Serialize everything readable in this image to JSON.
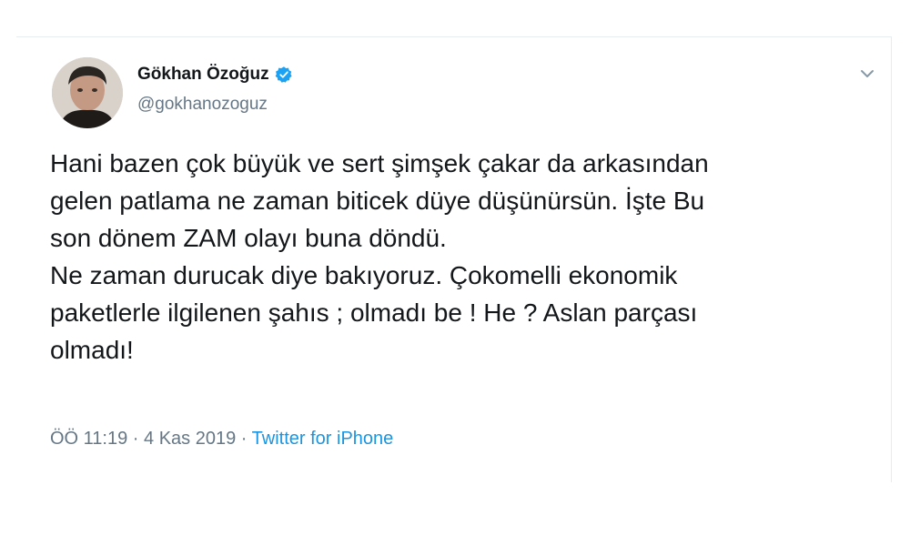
{
  "tweet": {
    "author": {
      "display_name": "Gökhan Özoğuz",
      "handle": "@gokhanozoguz",
      "verified": true,
      "verified_icon": "verified-badge-icon",
      "avatar_icon": "profile-photo"
    },
    "menu_icon": "chevron-down-icon",
    "text_lines": [
      "Hani bazen çok büyük ve sert şimşek çakar da arkasından",
      "gelen patlama ne zaman biticek düye düşünürsün. İşte Bu",
      "son dönem ZAM olayı buna döndü.",
      "Ne zaman durucak diye bakıyoruz. Çokomelli ekonomik",
      "paketlerle ilgilenen şahıs ; olmadı be ! He ? Aslan parçası",
      "olmadı!"
    ],
    "time": "ÖÖ 11:19",
    "separator_1": "·",
    "date": "4 Kas 2019",
    "separator_2": "·",
    "source": "Twitter for iPhone"
  },
  "colors": {
    "text": "#14171a",
    "secondary": "#657786",
    "link": "#1b95e0",
    "verified": "#1da1f2",
    "border": "#e6ecf0"
  }
}
